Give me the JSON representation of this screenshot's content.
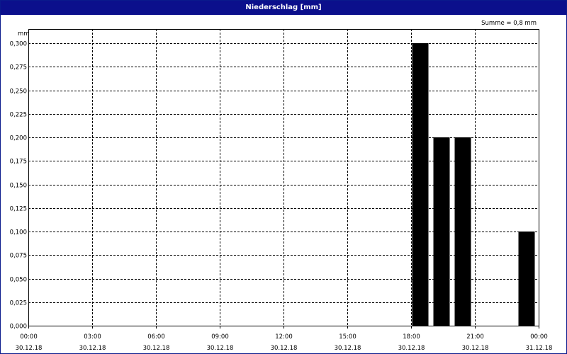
{
  "window": {
    "title": "Niederschlag [mm]"
  },
  "chart_data": {
    "type": "bar",
    "title": "Niederschlag [mm]",
    "ylabel": "mm",
    "annotation": "Summe = 0,8 mm",
    "ylim": [
      0,
      0.3
    ],
    "yticks": [
      "0,000",
      "0,025",
      "0,050",
      "0,075",
      "0,100",
      "0,125",
      "0,150",
      "0,175",
      "0,200",
      "0,225",
      "0,250",
      "0,275",
      "0,300"
    ],
    "xlim_hours": [
      0,
      24
    ],
    "xticks": [
      {
        "hour": 0,
        "time": "00:00",
        "date": "30.12.18"
      },
      {
        "hour": 3,
        "time": "03:00",
        "date": "30.12.18"
      },
      {
        "hour": 6,
        "time": "06:00",
        "date": "30.12.18"
      },
      {
        "hour": 9,
        "time": "09:00",
        "date": "30.12.18"
      },
      {
        "hour": 12,
        "time": "12:00",
        "date": "30.12.18"
      },
      {
        "hour": 15,
        "time": "15:00",
        "date": "30.12.18"
      },
      {
        "hour": 18,
        "time": "18:00",
        "date": "30.12.18"
      },
      {
        "hour": 21,
        "time": "21:00",
        "date": "30.12.18"
      },
      {
        "hour": 24,
        "time": "00:00",
        "date": "31.12.18"
      }
    ],
    "bars": [
      {
        "start": 18,
        "end": 19,
        "value": 0.3
      },
      {
        "start": 19,
        "end": 20,
        "value": 0.2
      },
      {
        "start": 20,
        "end": 21,
        "value": 0.2
      },
      {
        "start": 23,
        "end": 24,
        "value": 0.1
      }
    ],
    "grid": true,
    "bar_color": "#000000"
  }
}
